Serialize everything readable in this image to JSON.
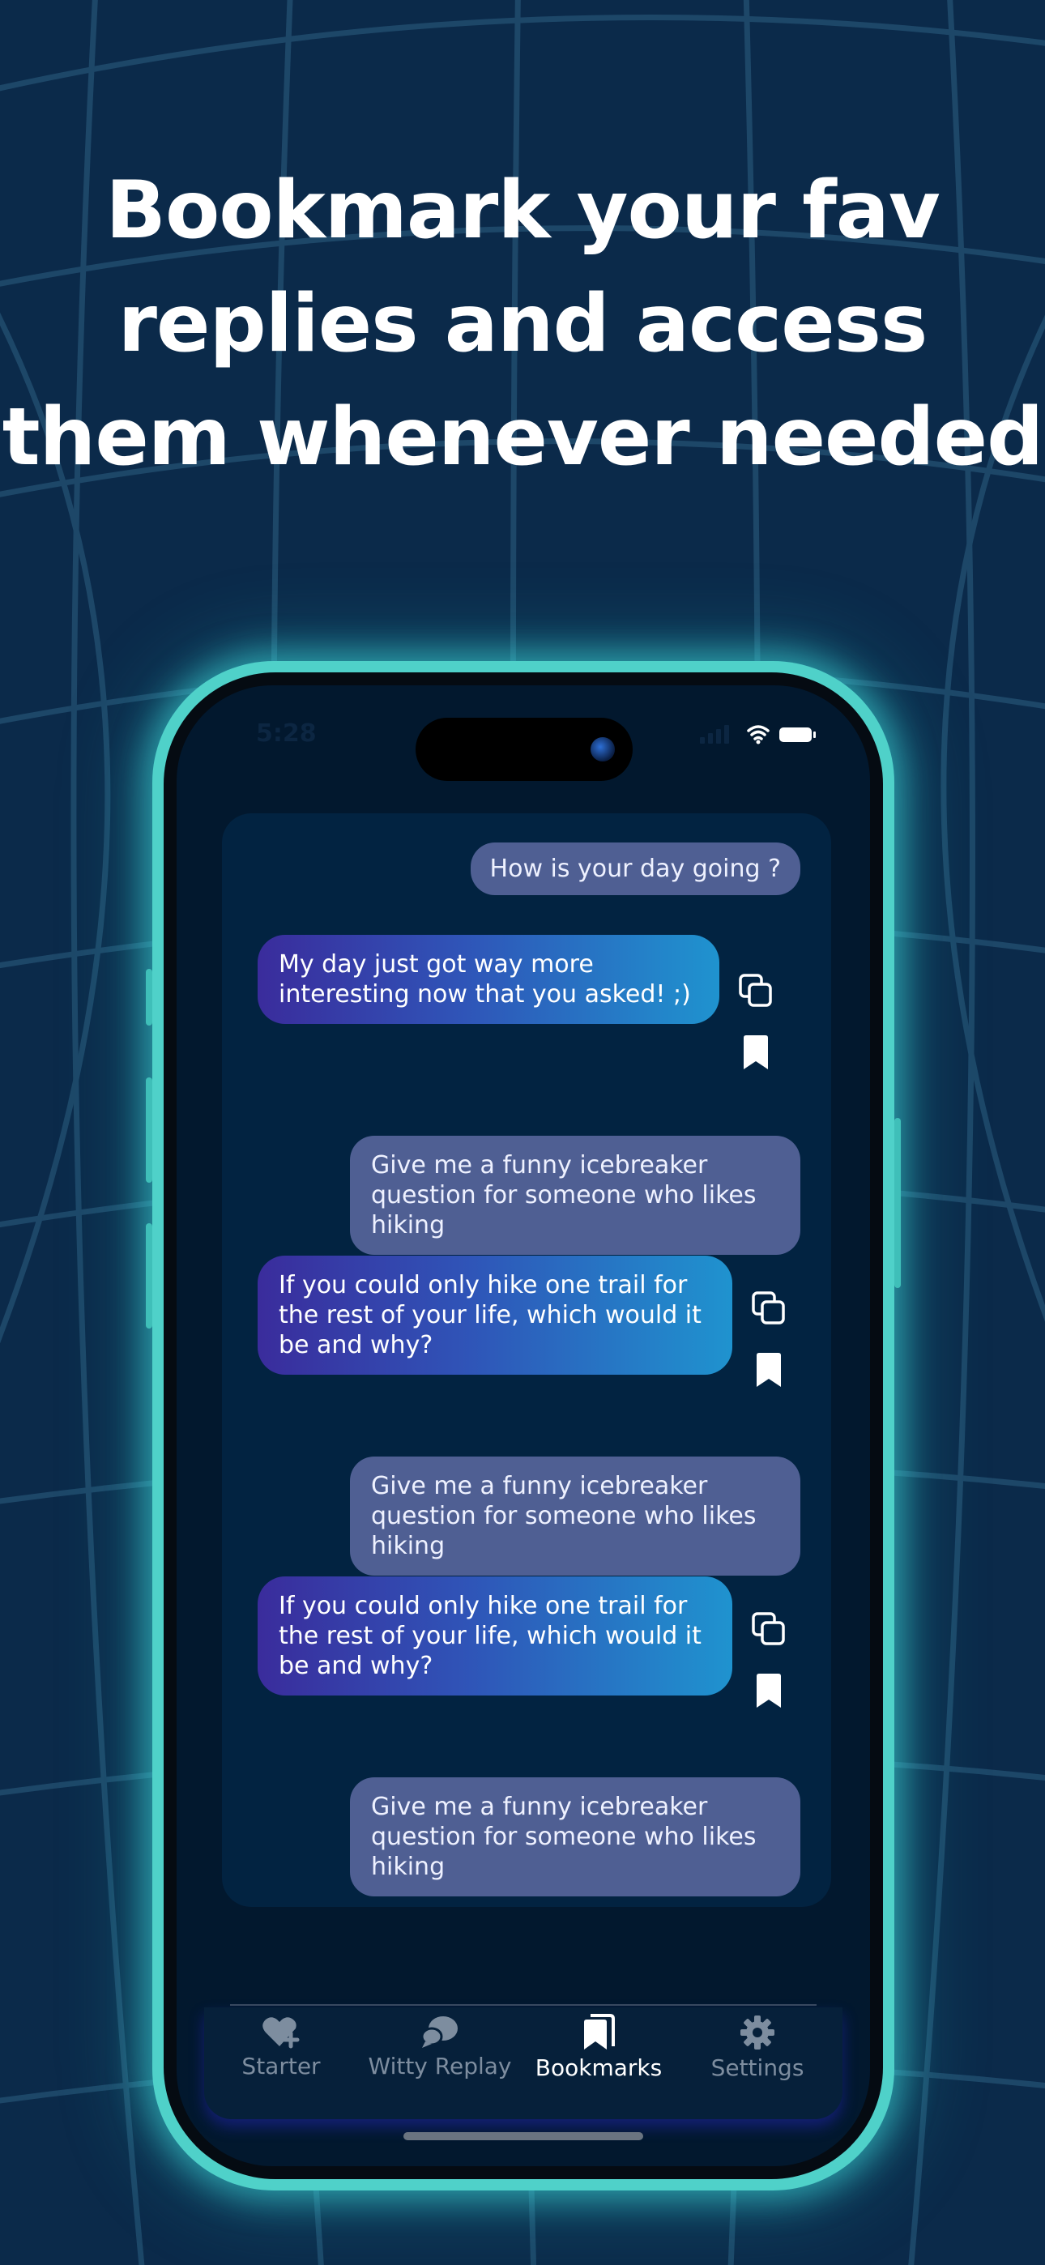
{
  "headline": {
    "line1": "Bookmark your fav",
    "line2": "replies and access",
    "line3": "them whenever needed"
  },
  "status_bar": {
    "time": "5:28"
  },
  "chat": {
    "messages": [
      {
        "role": "user",
        "text": "How is your day going ?"
      },
      {
        "role": "ai",
        "text": "My day just got way more interesting now that you asked! ;)"
      },
      {
        "role": "user",
        "text": "Give me a funny icebreaker question for someone who likes hiking"
      },
      {
        "role": "ai",
        "text": "If you could only hike one trail for the rest of your life, which would it be and why?"
      },
      {
        "role": "user",
        "text": "Give me a funny icebreaker question for someone who likes hiking"
      },
      {
        "role": "ai",
        "text": "If you could only hike one trail for the rest of your life, which would it be and why?"
      },
      {
        "role": "user",
        "text": "Give me a funny icebreaker question for someone who likes hiking"
      }
    ],
    "action_icons": [
      "copy-icon",
      "bookmark-icon"
    ]
  },
  "tabs": [
    {
      "label": "Starter",
      "icon": "heart-plus-icon",
      "active": false
    },
    {
      "label": "Witty Replay",
      "icon": "chat-bubbles-icon",
      "active": false
    },
    {
      "label": "Bookmarks",
      "icon": "bookmarks-icon",
      "active": true
    },
    {
      "label": "Settings",
      "icon": "gear-icon",
      "active": false
    }
  ],
  "colors": {
    "background": "#0b2a4a",
    "phone_glow": "#4fd1c9",
    "user_bubble": "#4f5f93",
    "ai_gradient_start": "#3a2c9c",
    "ai_gradient_end": "#1f93cf"
  }
}
